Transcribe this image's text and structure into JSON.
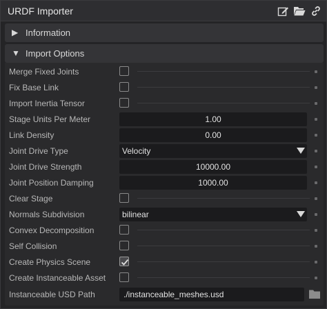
{
  "window": {
    "title": "URDF Importer"
  },
  "titlebar_icons": [
    "edit-icon",
    "folder-open-icon",
    "link-icon"
  ],
  "sections": {
    "information": {
      "label": "Information",
      "expanded": false
    },
    "import_options": {
      "label": "Import Options",
      "expanded": true
    }
  },
  "options": {
    "merge_fixed_joints": {
      "label": "Merge Fixed Joints",
      "checked": false
    },
    "fix_base_link": {
      "label": "Fix Base Link",
      "checked": false
    },
    "import_inertia_tensor": {
      "label": "Import Inertia Tensor",
      "checked": false
    },
    "stage_units_per_meter": {
      "label": "Stage Units Per Meter",
      "value": "1.00"
    },
    "link_density": {
      "label": "Link Density",
      "value": "0.00"
    },
    "joint_drive_type": {
      "label": "Joint Drive Type",
      "value": "Velocity"
    },
    "joint_drive_strength": {
      "label": "Joint Drive Strength",
      "value": "10000.00"
    },
    "joint_position_damping": {
      "label": "Joint Position Damping",
      "value": "1000.00"
    },
    "clear_stage": {
      "label": "Clear Stage",
      "checked": false
    },
    "normals_subdivision": {
      "label": "Normals Subdivision",
      "value": "bilinear"
    },
    "convex_decomposition": {
      "label": "Convex Decomposition",
      "checked": false
    },
    "self_collision": {
      "label": "Self Collision",
      "checked": false
    },
    "create_physics_scene": {
      "label": "Create Physics Scene",
      "checked": true
    },
    "create_instanceable_asset": {
      "label": "Create Instanceable Asset",
      "checked": false
    },
    "instanceable_usd_path": {
      "label": "Instanceable USD Path",
      "value": "./instanceable_meshes.usd"
    }
  }
}
